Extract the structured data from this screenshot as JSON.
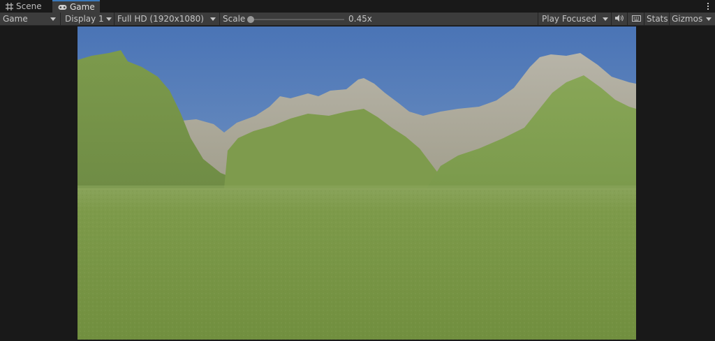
{
  "tabs": {
    "scene": {
      "label": "Scene",
      "icon": "grid-icon"
    },
    "game": {
      "label": "Game",
      "icon": "gamepad-icon",
      "active": true
    }
  },
  "toolbar": {
    "view_select": "Game",
    "display_select": "Display 1",
    "resolution_select": "Full HD (1920x1080)",
    "scale_label": "Scale",
    "scale_value": "0.45x",
    "play_mode_select": "Play Focused",
    "stats_label": "Stats",
    "gizmos_label": "Gizmos"
  },
  "colors": {
    "panel_bg": "#191919",
    "toolbar_bg": "#3c3c3c",
    "active_tab_accent": "#3a79bb",
    "sky_top": "#4f79b9",
    "sky_bottom": "#8da8c6",
    "grass": "#7b9a46"
  },
  "game_view": {
    "scene_description_icon": "terrain-scene"
  }
}
